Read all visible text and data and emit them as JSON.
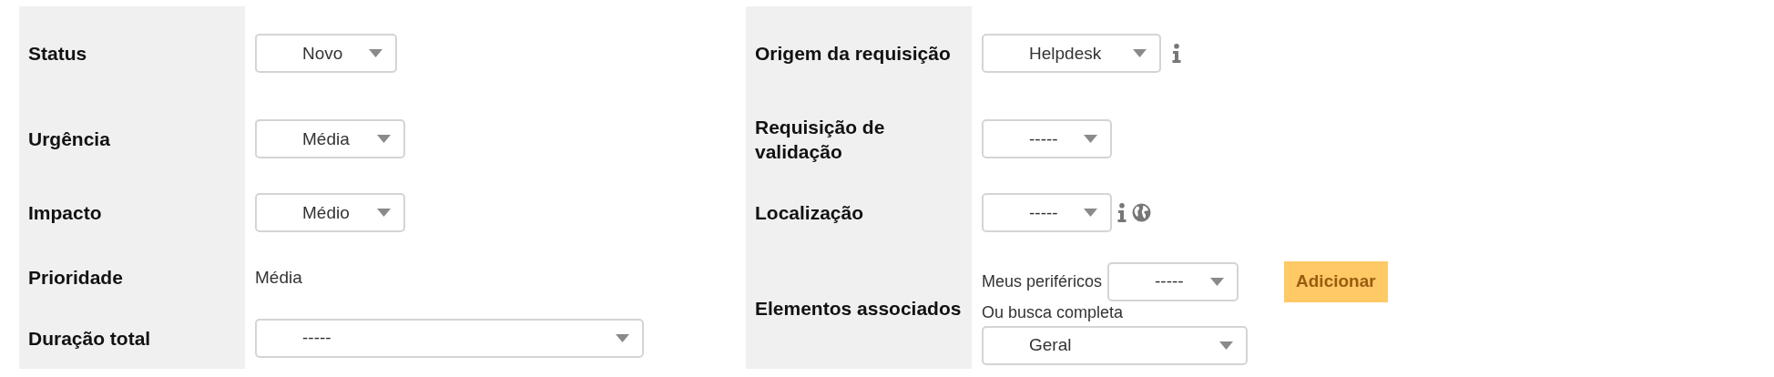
{
  "left": [
    {
      "label": "Status",
      "field": {
        "kind": "select",
        "value": "Novo"
      }
    },
    {
      "label": "Urgência",
      "field": {
        "kind": "select",
        "value": "Média"
      }
    },
    {
      "label": "Impacto",
      "field": {
        "kind": "select",
        "value": "Médio"
      }
    },
    {
      "label": "Prioridade",
      "field": {
        "kind": "text",
        "value": "Média"
      }
    },
    {
      "label": "Duração total",
      "field": {
        "kind": "select",
        "value": "-----"
      }
    }
  ],
  "right": [
    {
      "label": "Origem da requisição",
      "field": {
        "kind": "select",
        "value": "Helpdesk"
      },
      "icons": [
        {
          "kind": "info"
        }
      ]
    },
    {
      "label": "Requisição de validação",
      "field": {
        "kind": "select",
        "value": "-----"
      }
    },
    {
      "label": "Localização",
      "field": {
        "kind": "select",
        "value": "-----"
      },
      "icons": [
        {
          "kind": "info"
        },
        {
          "kind": "globe"
        }
      ]
    },
    {
      "label": "Elementos associados",
      "field": {
        "kind": "associated",
        "mine_label": "Meus periféricos",
        "mine_value": "-----",
        "button": "Adicionar",
        "search_label": "Ou busca completa",
        "search_value": "Geral"
      }
    }
  ]
}
